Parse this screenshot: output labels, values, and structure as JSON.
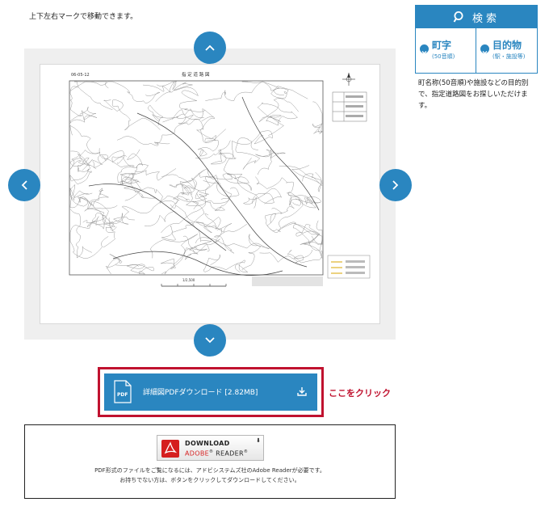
{
  "instruction": "上下左右マークで移動できます。",
  "map": {
    "sheet_id": "06-05-12",
    "title": "指 定 道 路 図",
    "scale": "1/2,500"
  },
  "download": {
    "label": "詳細図PDFダウンロード [2.82MB]",
    "click_note": "ここをクリック"
  },
  "reader": {
    "line1": "DOWNLOAD",
    "line2a": "ADOBE",
    "line2b": "READER",
    "text1": "PDF形式のファイルをご覧になるには、アドビシステムズ社のAdobe Readerが必要です。",
    "text2": "お持ちでない方は、ボタンをクリックしてダウンロードしてください。"
  },
  "search": {
    "header": "検索",
    "col1_title": "町字",
    "col1_sub": "(50音順)",
    "col2_title": "目的物",
    "col2_sub": "(駅・施設等)",
    "description": "町名称(50音順)や施設などの目的別で、指定道路図をお探しいただけます。"
  },
  "colors": {
    "accent": "#2a86c0",
    "alert": "#c0122f",
    "frame": "#efefef"
  }
}
